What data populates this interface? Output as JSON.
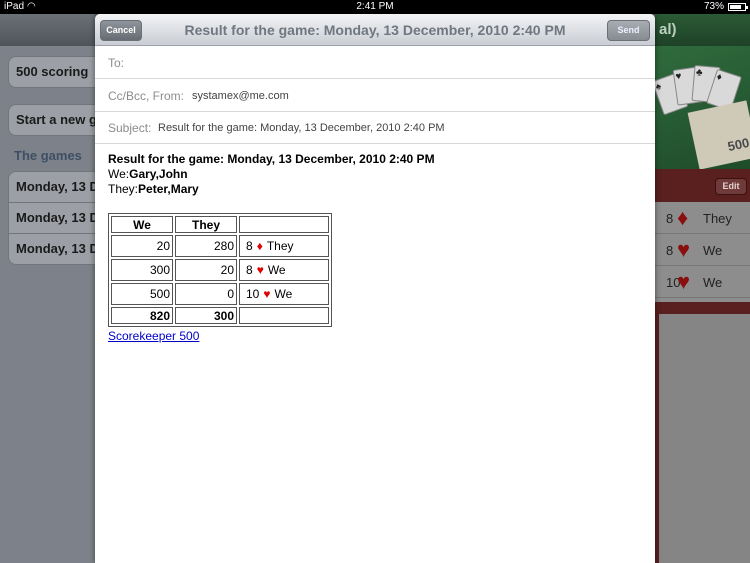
{
  "status_bar": {
    "device": "iPad",
    "wifi_icon": "wifi-icon",
    "time": "2:41 PM",
    "battery_pct": "73%"
  },
  "background_app": {
    "left": {
      "cell_scoring": "500 scoring",
      "cell_new_game": "Start a new g",
      "section_header": "The games",
      "games": [
        "Monday, 13 D",
        "Monday, 13 D",
        "Monday, 13 D"
      ]
    },
    "right": {
      "nav_title_fragment": "al)",
      "pad_label": "500",
      "edit_label": "Edit",
      "rows": [
        {
          "num": "8",
          "suit": "♦",
          "who": "They"
        },
        {
          "num": "8",
          "suit": "♥",
          "who": "We"
        },
        {
          "num": "10",
          "suit": "♥",
          "who": "We"
        }
      ]
    }
  },
  "compose": {
    "cancel_label": "Cancel",
    "send_label": "Send",
    "title": "Result for the game: Monday, 13 December, 2010 2:40 PM",
    "to_label": "To:",
    "cc_label": "Cc/Bcc, From:",
    "from_value": "systamex@me.com",
    "subject_label": "Subject:",
    "subject_value": "Result for the game: Monday, 13 December, 2010 2:40 PM",
    "body": {
      "heading": "Result for the game: Monday, 13 December, 2010 2:40 PM",
      "we_prefix": "We:",
      "we_players": "Gary,John",
      "they_prefix": "They:",
      "they_players": "Peter,Mary",
      "table": {
        "headers": [
          "We",
          "They",
          ""
        ],
        "rows": [
          {
            "we": "20",
            "they": "280",
            "bid_num": "8",
            "bid_suit": "♦",
            "bid_team": "They"
          },
          {
            "we": "300",
            "they": "20",
            "bid_num": "8",
            "bid_suit": "♥",
            "bid_team": "We"
          },
          {
            "we": "500",
            "they": "0",
            "bid_num": "10",
            "bid_suit": "♥",
            "bid_team": "We"
          }
        ],
        "total_we": "820",
        "total_they": "300"
      },
      "link_text": "Scorekeeper 500"
    }
  }
}
